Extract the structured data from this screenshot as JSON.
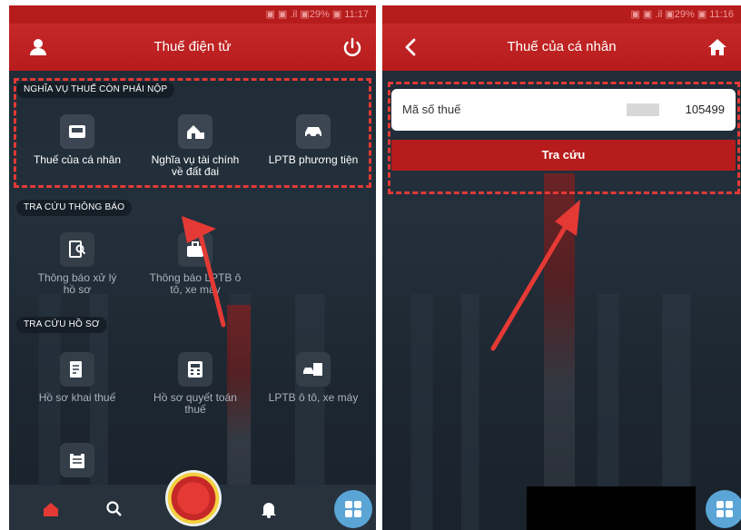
{
  "left_screen": {
    "status": "▣ ▣ .il ▣29% ▣ 11:17",
    "title": "Thuế điện tử",
    "sections": [
      {
        "label": "NGHĨA VỤ THUẾ CÒN PHẢI NỘP",
        "items": [
          {
            "label": "Thuế của cá nhân",
            "icon": "wallet-icon"
          },
          {
            "label": "Nghĩa vụ tài chính về đất đai",
            "icon": "house-icon"
          },
          {
            "label": "LPTB phương tiện",
            "icon": "car-icon"
          }
        ]
      },
      {
        "label": "TRA CỨU THÔNG BÁO",
        "items": [
          {
            "label": "Thông báo xử lý hồ sơ",
            "icon": "document-search-icon"
          },
          {
            "label": "Thông báo LPTB ô tô, xe máy",
            "icon": "briefcase-icon"
          }
        ]
      },
      {
        "label": "TRA CỨU HỒ SƠ",
        "items": [
          {
            "label": "Hồ sơ khai thuế",
            "icon": "document-edit-icon"
          },
          {
            "label": "Hồ sơ quyết toán thuế",
            "icon": "calculator-icon"
          },
          {
            "label": "LPTB ô tô, xe máy",
            "icon": "vehicle-doc-icon"
          },
          {
            "label": "",
            "icon": "clipboard-icon"
          }
        ]
      }
    ],
    "bottom_nav": [
      "home-icon",
      "search-icon",
      "emblem-icon",
      "bell-icon",
      "grid-icon"
    ]
  },
  "right_screen": {
    "status": "▣ ▣ .il ▣29% ▣ 11:16",
    "title": "Thuế của cá nhân",
    "tax_code_label": "Mã số thuế",
    "tax_code_value": "105499",
    "lookup_button": "Tra cứu"
  },
  "colors": {
    "header_red": "#b71c1c",
    "highlight": "#e53935",
    "fab_blue": "#5aa5d6"
  }
}
